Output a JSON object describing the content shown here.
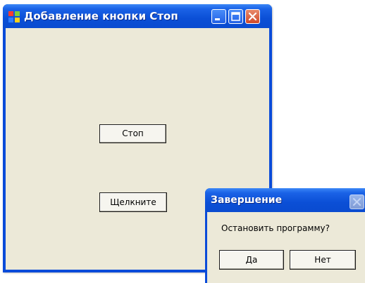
{
  "main_window": {
    "title": "Добавление кнопки Стоп",
    "buttons": {
      "stop_label": "Стоп",
      "click_label": "Щелкните"
    },
    "caption_icons": [
      "minimize-icon",
      "maximize-icon",
      "close-icon"
    ],
    "app_icon": "app-window-icon"
  },
  "dialog": {
    "title": "Завершение",
    "message": "Остановить программу?",
    "yes_label": "Да",
    "no_label": "Нет",
    "close_icon": "close-icon"
  },
  "colors": {
    "titlebar": "#0a4bd9",
    "client_bg": "#ece9d8",
    "close_button": "#d0492a"
  }
}
